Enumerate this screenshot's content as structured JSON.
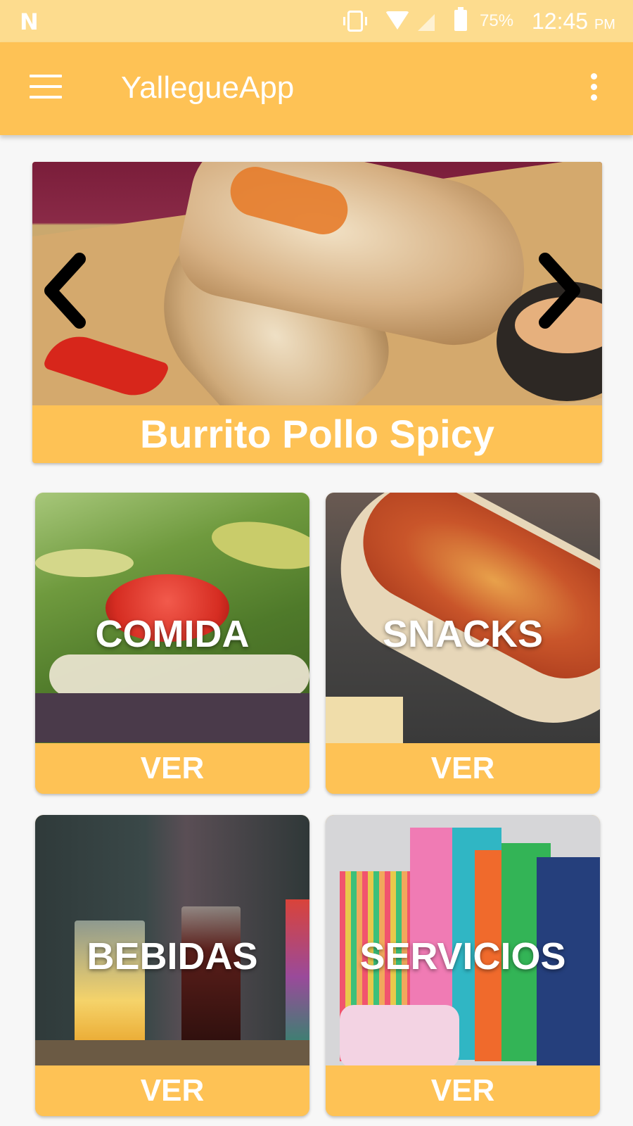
{
  "status_bar": {
    "battery_percent": "75%",
    "time": "12:45",
    "ampm": "PM"
  },
  "app_bar": {
    "title": "YallegueApp"
  },
  "slider": {
    "caption": "Burrito Pollo Spicy"
  },
  "categories": [
    {
      "label": "COMIDA",
      "button": "VER"
    },
    {
      "label": "SNACKS",
      "button": "VER"
    },
    {
      "label": "BEBIDAS",
      "button": "VER"
    },
    {
      "label": "SERVICIOS",
      "button": "VER"
    }
  ],
  "colors": {
    "accent": "#fec255",
    "status_bar": "#fddc8e",
    "background": "#f7f7f7"
  }
}
